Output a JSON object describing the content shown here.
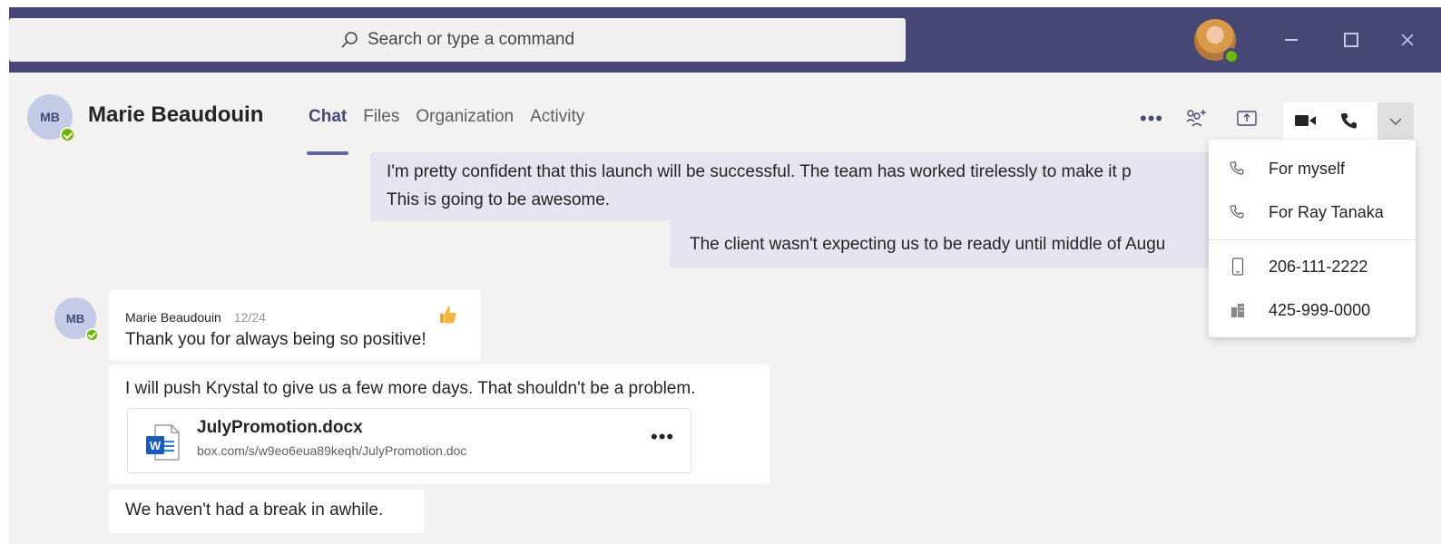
{
  "search": {
    "placeholder": "Search or type a command"
  },
  "colors": {
    "titlebar": "#464775",
    "accent": "#6264a7",
    "presence": "#6bb700",
    "chat_bg": "#f3f2f1",
    "my_message_bg": "#e5e5f1"
  },
  "header": {
    "avatar_initials": "MB",
    "name": "Marie Beaudouin",
    "tabs": [
      {
        "label": "Chat",
        "active": true
      },
      {
        "label": "Files",
        "active": false
      },
      {
        "label": "Organization",
        "active": false
      },
      {
        "label": "Activity",
        "active": false
      }
    ],
    "icons": [
      "more-options-icon",
      "add-people-icon",
      "share-screen-icon",
      "video-call-icon",
      "audio-call-icon",
      "chevron-down-icon"
    ]
  },
  "messages": {
    "sent": [
      {
        "lines": [
          "I'm pretty confident that this launch will be successful. The team has worked tirelessly to make it p",
          "This is going to be awesome."
        ]
      },
      {
        "lines": [
          "The client wasn't expecting us to be ready until middle of Augu"
        ]
      }
    ],
    "received": {
      "sender_initials": "MB",
      "sender": "Marie Beaudouin",
      "time": "12/24",
      "reaction": "like",
      "first": "Thank you for always being so positive!",
      "second": "I will push Krystal to give us a few more days. That shouldn't be a problem.",
      "attachment": {
        "name": "JulyPromotion.docx",
        "path": "box.com/s/w9eo6eua89keqh/JulyPromotion.doc",
        "icon": "word-icon"
      },
      "third": "We haven't had a break in awhile."
    }
  },
  "call_menu": {
    "items": [
      {
        "label": "For myself",
        "icon": "phone-icon"
      },
      {
        "label": "For Ray Tanaka",
        "icon": "phone-icon"
      },
      {
        "label": "206-111-2222",
        "icon": "mobile-phone-icon"
      },
      {
        "label": "425-999-0000",
        "icon": "office-building-icon"
      }
    ]
  }
}
